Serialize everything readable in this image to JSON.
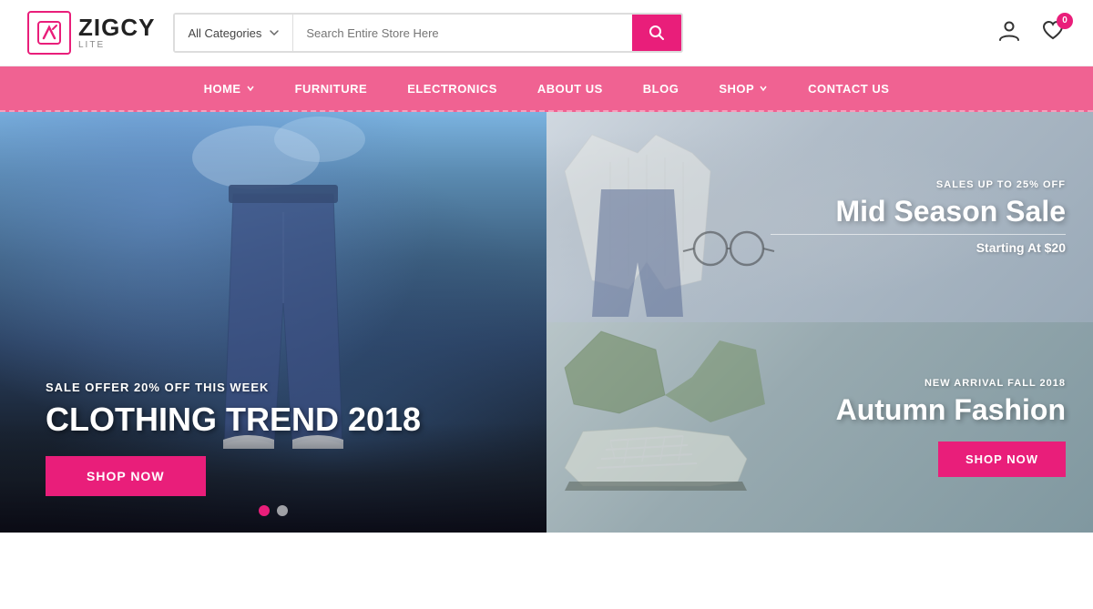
{
  "logo": {
    "brand": "ZIGCY",
    "sub": "LITE"
  },
  "header": {
    "category_label": "All Categories",
    "search_placeholder": "Search Entire Store Here",
    "cart_badge": "0"
  },
  "nav": {
    "items": [
      {
        "label": "HOME",
        "has_dropdown": true
      },
      {
        "label": "FURNITURE",
        "has_dropdown": false
      },
      {
        "label": "ELECTRONICS",
        "has_dropdown": false
      },
      {
        "label": "ABOUT US",
        "has_dropdown": false
      },
      {
        "label": "BLOG",
        "has_dropdown": false
      },
      {
        "label": "SHOP",
        "has_dropdown": true
      },
      {
        "label": "CONTACT US",
        "has_dropdown": false
      }
    ]
  },
  "hero_left": {
    "sale_tag": "SALE OFFER 20% OFF THIS WEEK",
    "title": "CLOTHING TREND 2018",
    "cta": "SHOP NOW"
  },
  "hero_panel_top": {
    "tag": "SALES UP TO 25% OFF",
    "title": "Mid Season Sale",
    "sub": "Starting At $20"
  },
  "hero_panel_bottom": {
    "tag": "NEW ARRIVAL FALL 2018",
    "title": "Autumn Fashion",
    "cta": "SHOP NOW"
  },
  "colors": {
    "pink": "#e91e7a",
    "nav_pink": "#f06292",
    "white": "#ffffff"
  }
}
